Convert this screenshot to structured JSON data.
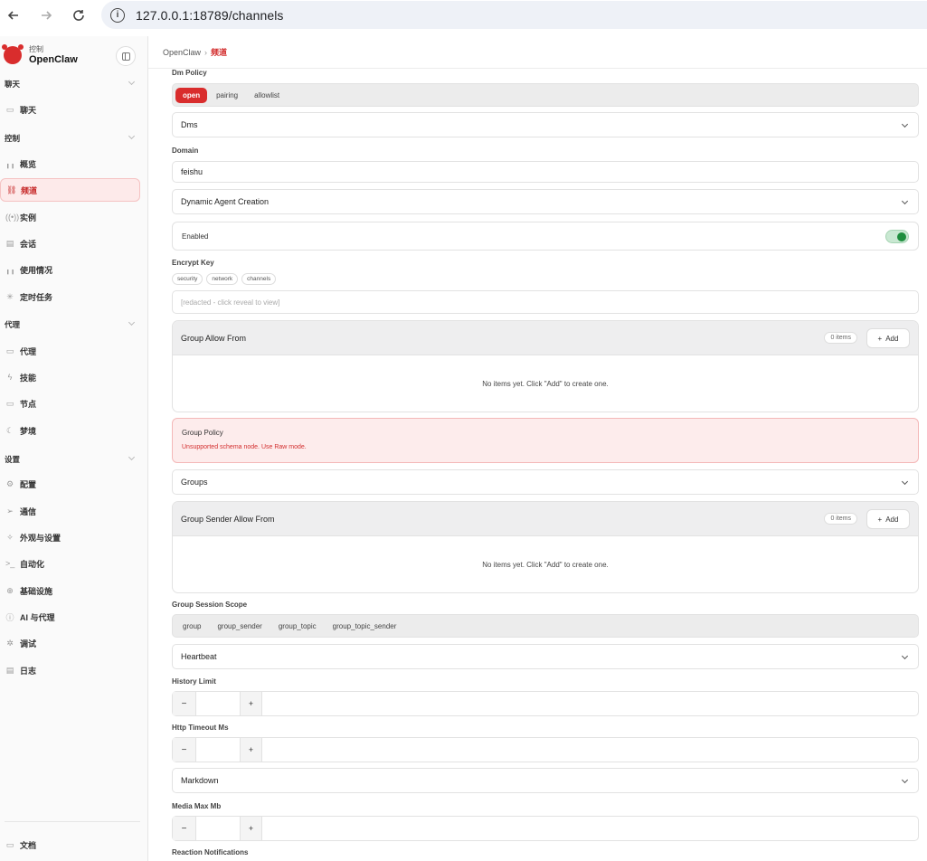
{
  "browser": {
    "url": "127.0.0.1:18789/channels"
  },
  "brand": {
    "sub": "控制",
    "name": "OpenClaw"
  },
  "sidebar": {
    "sections": [
      {
        "title": "聊天"
      },
      {
        "title": "控制"
      },
      {
        "title": "代理"
      },
      {
        "title": "设置"
      }
    ],
    "items": [
      {
        "label": "聊天",
        "icon": "message-icon",
        "glyph": "▭"
      },
      {
        "label": "概览",
        "icon": "bar-chart-icon",
        "glyph": "╻╻"
      },
      {
        "label": "频道",
        "icon": "link-icon",
        "glyph": "⛓"
      },
      {
        "label": "实例",
        "icon": "broadcast-icon",
        "glyph": "((•))"
      },
      {
        "label": "会话",
        "icon": "document-icon",
        "glyph": "▤"
      },
      {
        "label": "使用情况",
        "icon": "bar-chart-icon",
        "glyph": "╻╻"
      },
      {
        "label": "定时任务",
        "icon": "loader-icon",
        "glyph": "✳"
      },
      {
        "label": "代理",
        "icon": "folder-icon",
        "glyph": "▭"
      },
      {
        "label": "技能",
        "icon": "lightning-icon",
        "glyph": "ϟ"
      },
      {
        "label": "节点",
        "icon": "monitor-icon",
        "glyph": "▭"
      },
      {
        "label": "梦境",
        "icon": "moon-icon",
        "glyph": "☾"
      },
      {
        "label": "配置",
        "icon": "gear-icon",
        "glyph": "⚙"
      },
      {
        "label": "通信",
        "icon": "send-icon",
        "glyph": "➢"
      },
      {
        "label": "外观与设置",
        "icon": "sparkle-icon",
        "glyph": "✧"
      },
      {
        "label": "自动化",
        "icon": "terminal-icon",
        "glyph": ">_"
      },
      {
        "label": "基础设施",
        "icon": "globe-icon",
        "glyph": "⊕"
      },
      {
        "label": "AI 与代理",
        "icon": "info-icon",
        "glyph": "ⓘ"
      },
      {
        "label": "调试",
        "icon": "bug-icon",
        "glyph": "✲"
      },
      {
        "label": "日志",
        "icon": "file-text-icon",
        "glyph": "▤"
      }
    ],
    "footer": {
      "label": "文档",
      "icon": "book-icon",
      "glyph": "▭"
    }
  },
  "breadcrumb": {
    "root": "OpenClaw",
    "sep": "›",
    "current": "频道"
  },
  "form": {
    "dm_policy": {
      "label": "Dm Policy",
      "options": [
        "open",
        "pairing",
        "allowlist"
      ],
      "selected": "open"
    },
    "dms": {
      "label": "Dms"
    },
    "domain": {
      "label": "Domain",
      "value": "feishu"
    },
    "dynamic_agent": {
      "label": "Dynamic Agent Creation"
    },
    "enabled": {
      "label": "Enabled",
      "on": true
    },
    "encrypt_key": {
      "label": "Encrypt Key",
      "tags": [
        "security",
        "network",
        "channels"
      ],
      "placeholder": "[redacted - click reveal to view]"
    },
    "group_allow_from": {
      "label": "Group Allow From",
      "count": "0 items",
      "add": "Add",
      "empty": "No items yet. Click \"Add\" to create one."
    },
    "group_policy": {
      "label": "Group Policy",
      "message": "Unsupported schema node. Use Raw mode."
    },
    "groups": {
      "label": "Groups"
    },
    "group_sender_allow_from": {
      "label": "Group Sender Allow From",
      "count": "0 items",
      "add": "Add",
      "empty": "No items yet. Click \"Add\" to create one."
    },
    "group_session_scope": {
      "label": "Group Session Scope",
      "options": [
        "group",
        "group_sender",
        "group_topic",
        "group_topic_sender"
      ]
    },
    "heartbeat": {
      "label": "Heartbeat"
    },
    "history_limit": {
      "label": "History Limit",
      "minus": "−",
      "plus": "+"
    },
    "http_timeout": {
      "label": "Http Timeout Ms",
      "minus": "−",
      "plus": "+"
    },
    "markdown": {
      "label": "Markdown"
    },
    "media_max": {
      "label": "Media Max Mb",
      "minus": "−",
      "plus": "+"
    },
    "reaction_notifications": {
      "label": "Reaction Notifications"
    }
  },
  "colors": {
    "accent": "#d92d2d",
    "toggle_on": "#1e8e3e",
    "alert_bg": "#fdecec"
  }
}
